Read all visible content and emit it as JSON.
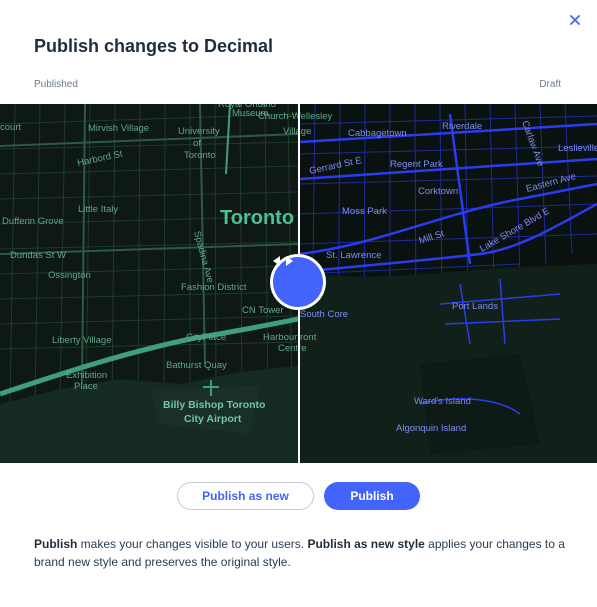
{
  "dialog": {
    "title": "Publish changes to Decimal",
    "close_icon": "close-icon"
  },
  "compare": {
    "left_label": "Published",
    "right_label": "Draft",
    "handle_icon": "left-right-arrows-icon",
    "colors": {
      "published_roads": "#3f9e7e",
      "draft_roads": "#2a3cf0",
      "map_background": "#0c1512",
      "accent": "#4264fb"
    },
    "map_labels_left": [
      "Royal Ontario Museum",
      "Mirvish Village",
      "University of Toronto",
      "Harbord St",
      "Little Italy",
      "Dufferin Grove",
      "Dundas St W",
      "Ossington",
      "Toronto",
      "Spadina Ave",
      "Fashion District",
      "CN Tower",
      "CityPlace",
      "Liberty Village",
      "Exhibition Place",
      "Bathurst Quay",
      "Billy Bishop Toronto City Airport",
      "Harbourfront Centre",
      "Church-Wellesley Village",
      "court"
    ],
    "map_labels_right": [
      "Cabbagetown",
      "Riverdale",
      "Gerrard St E",
      "Regent Park",
      "Corktown",
      "Moss Park",
      "Mill St",
      "St. Lawrence",
      "Lake Shore Blvd E",
      "Eastern Ave",
      "Carlaw Ave",
      "Leslieville",
      "South Core",
      "Port Lands",
      "Ward's Island",
      "Algonquin Island"
    ]
  },
  "actions": {
    "publish_as_new": "Publish as new",
    "publish": "Publish"
  },
  "note": {
    "publish_term": "Publish",
    "publish_desc": " makes your changes visible to your users. ",
    "publish_new_term": "Publish as new style",
    "publish_new_desc": " applies your changes to a brand new style and preserves the original style."
  }
}
